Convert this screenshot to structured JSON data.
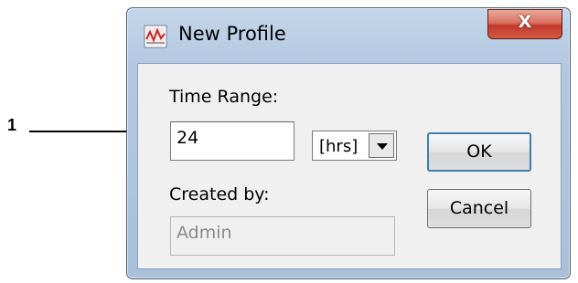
{
  "callout": {
    "number": "1"
  },
  "dialog": {
    "title": "New Profile",
    "close_label": "X",
    "time_range": {
      "label": "Time Range:",
      "value": "24",
      "unit": "[hrs]"
    },
    "created_by": {
      "label": "Created by:",
      "value": "Admin"
    },
    "ok_label": "OK",
    "cancel_label": "Cancel"
  },
  "colors": {
    "frame": "#b3c9e1",
    "close_button": "#c1392a",
    "client_bg": "#f0f0f0"
  },
  "icons": {
    "app": "profile-chart-icon",
    "combo": "chevron-down-icon"
  }
}
